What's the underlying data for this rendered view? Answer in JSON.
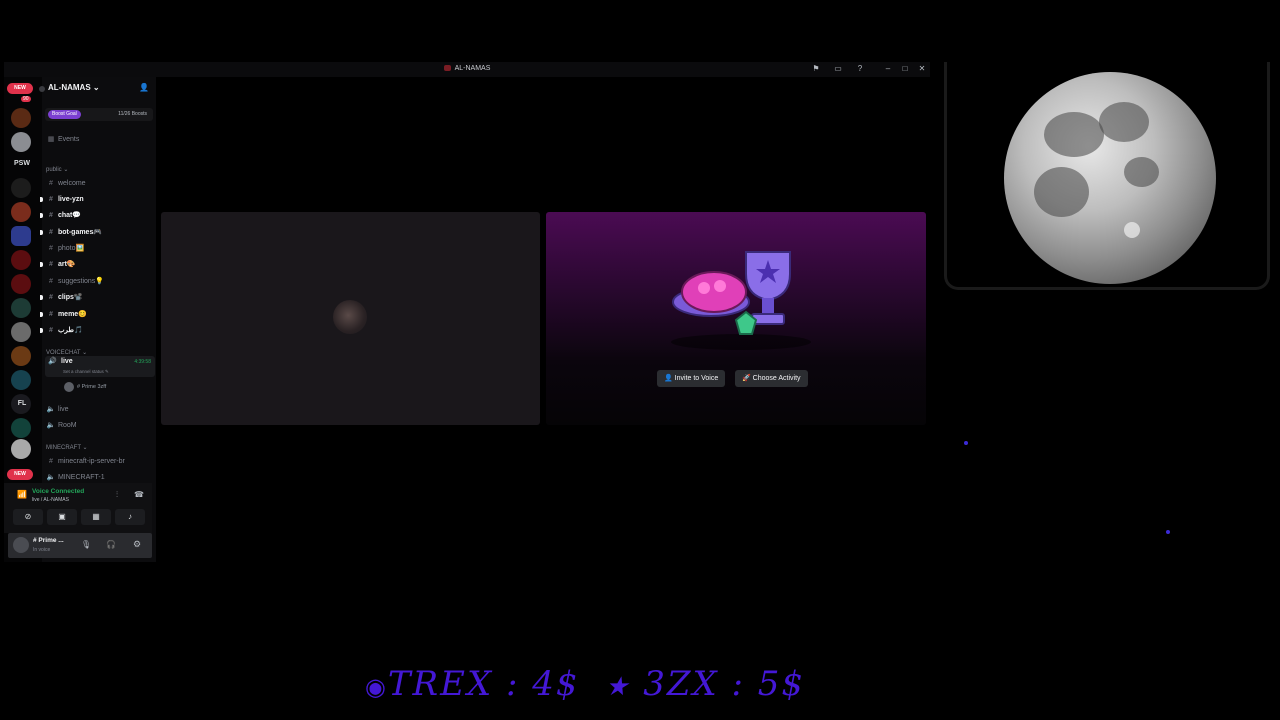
{
  "window": {
    "title": "AL-NAMAS"
  },
  "rail": {
    "top_badge": "NEW",
    "top_badge_count": "90",
    "text_servers": [
      "PSW",
      "FL"
    ],
    "bottom_badge": "NEW"
  },
  "sidebar": {
    "guild_name": "AL-NAMAS",
    "boost_label": "Boost Goal",
    "boost_count": "11/26 Boosts",
    "events": "Events",
    "category_public": "public",
    "channels": [
      {
        "name": "welcome",
        "unread": false
      },
      {
        "name": "live-yzn",
        "unread": true
      },
      {
        "name": "chat💬",
        "unread": true
      },
      {
        "name": "bot-games🎮",
        "unread": true
      },
      {
        "name": "photo🖼️",
        "unread": false
      },
      {
        "name": "art🎨",
        "unread": true
      },
      {
        "name": "suggestions💡",
        "unread": false
      },
      {
        "name": "clips📽️",
        "unread": true
      },
      {
        "name": "meme😊",
        "unread": true
      },
      {
        "name": "طرب🎵",
        "unread": true
      }
    ],
    "category_voice": "VOICECHAT",
    "voice_live": {
      "name": "live",
      "timer": "4:39:58",
      "status_hint": "Set a channel status",
      "member": "# Prime 3zff"
    },
    "voice_channels": [
      "live",
      "RooM"
    ],
    "category_minecraft": "MINECRAFT",
    "mc_text": "minecraft-ip-server-br",
    "mc_voice": "MINECRAFT-1"
  },
  "voice_panel": {
    "status": "Voice Connected",
    "channel": "live / AL-NAMAS"
  },
  "user_panel": {
    "name": "# Prime ...",
    "status": "In voice"
  },
  "activity": {
    "invite_label": "Invite to Voice",
    "choose_label": "Choose Activity"
  },
  "ticker": {
    "text1": "TREX : 4$",
    "text2": "3ZX : 5$"
  },
  "colors": {
    "accent": "#4418d6",
    "voice_green": "#23a55a",
    "new_badge": "#e0324b"
  }
}
